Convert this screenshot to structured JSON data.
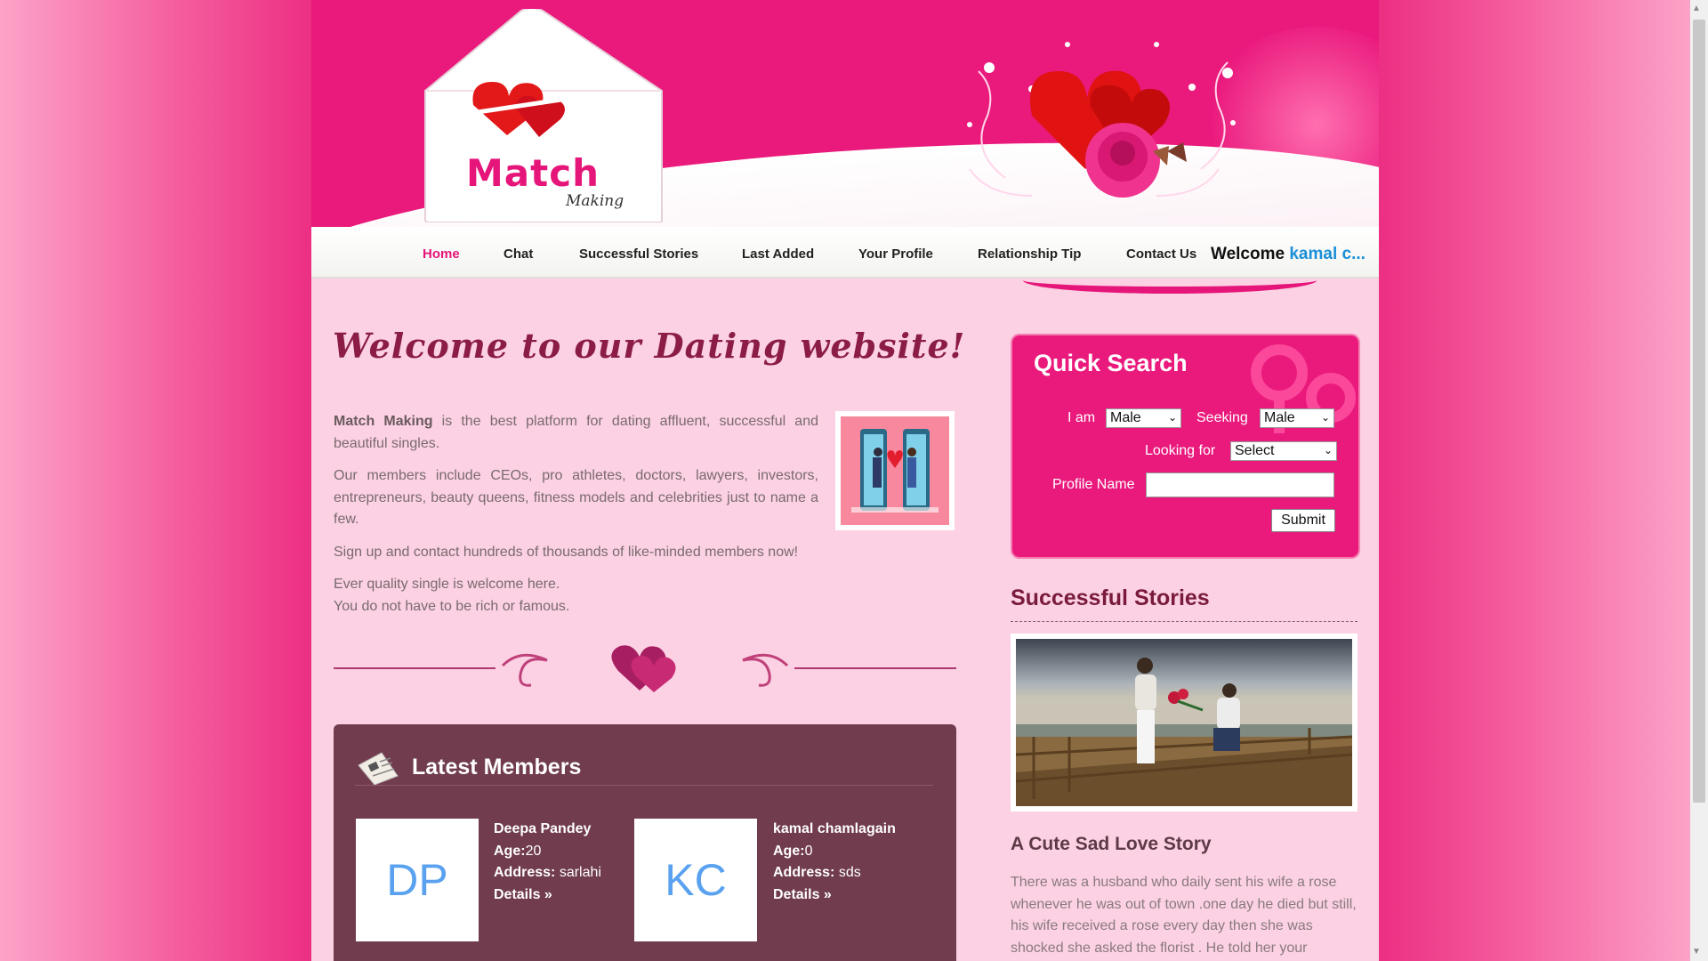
{
  "logo": {
    "title": "Match",
    "subtitle": "Making"
  },
  "nav": {
    "items": [
      "Home",
      "Chat",
      "Successful Stories",
      "Last Added",
      "Your Profile",
      "Relationship Tip",
      "Contact Us"
    ],
    "active": "Home",
    "welcome_label": "Welcome",
    "welcome_name": "kamal c..."
  },
  "intro": {
    "heading": "Welcome to our Dating website!",
    "brand": "Match Making",
    "p1_rest": " is the best platform for dating affluent, successful and beautiful singles.",
    "p2": "Our members include CEOs, pro athletes, doctors, lawyers, investors, entrepreneurs, beauty queens, fitness models and celebrities just to name a few.",
    "p3": "Sign up and contact hundreds of thousands of like-minded members now!",
    "p4_line1": "Ever quality single is welcome here.",
    "p4_line2": "You do not have to be rich or famous."
  },
  "latest_members": {
    "title": "Latest Members",
    "labels": {
      "age": "Age:",
      "address": "Address:",
      "details": "Details »"
    },
    "members": [
      {
        "initials": "DP",
        "name": "Deepa Pandey",
        "age": "20",
        "address": "sarlahi"
      },
      {
        "initials": "KC",
        "name": "kamal chamlagain",
        "age": "0",
        "address": "sds"
      }
    ]
  },
  "quick_search": {
    "title": "Quick Search",
    "i_am_label": "I am",
    "i_am_value": "Male",
    "seeking_label": "Seeking",
    "seeking_value": "Male",
    "looking_for_label": "Looking for",
    "looking_for_value": "Select",
    "profile_name_label": "Profile Name",
    "profile_name_value": "",
    "submit_label": "Submit"
  },
  "successful_stories": {
    "heading": "Successful Stories",
    "story_title": "A Cute Sad Love Story",
    "story_text": "There was a husband who daily sent his wife a rose whenever he was out of town .one day he died but still, his wife received a rose every day then she was shocked she asked the florist . He told her your"
  },
  "colors": {
    "brand_pink": "#ea1a7d",
    "page_bg": "#fbd1e3",
    "members_bg": "#703c4e",
    "heading_maroon": "#7a1a3c",
    "link_blue": "#1a8fd8"
  }
}
